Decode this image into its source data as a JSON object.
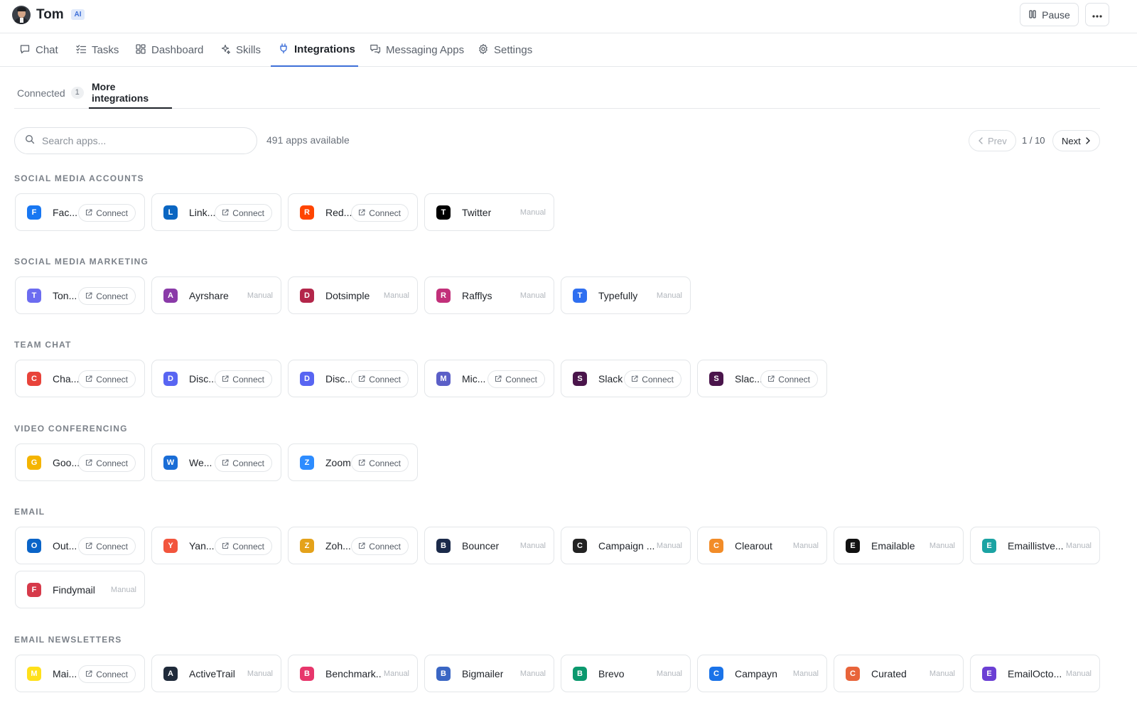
{
  "header": {
    "agent_name": "Tom",
    "ai_badge": "AI",
    "pause_label": "Pause"
  },
  "nav": {
    "tabs": [
      {
        "label": "Chat",
        "icon": "chat-icon"
      },
      {
        "label": "Tasks",
        "icon": "tasks-icon"
      },
      {
        "label": "Dashboard",
        "icon": "dashboard-icon"
      },
      {
        "label": "Skills",
        "icon": "sparkle-icon"
      },
      {
        "label": "Integrations",
        "icon": "plug-icon",
        "active": true
      },
      {
        "label": "Messaging Apps",
        "icon": "messages-icon"
      },
      {
        "label": "Settings",
        "icon": "gear-icon"
      }
    ]
  },
  "subtabs": {
    "connected_label": "Connected",
    "connected_count": "1",
    "more_label": "More integrations"
  },
  "search": {
    "placeholder": "Search apps...",
    "apps_count": "491 apps available"
  },
  "pagination": {
    "prev": "Prev",
    "page": "1 / 10",
    "next": "Next"
  },
  "connect_label": "Connect",
  "manual_label": "Manual",
  "sections": [
    {
      "title": "SOCIAL MEDIA ACCOUNTS",
      "cards": [
        {
          "name": "Fac...",
          "action": "connect",
          "icon": "facebook-icon",
          "color": "#1877f2"
        },
        {
          "name": "Link...",
          "action": "connect",
          "icon": "linkedin-icon",
          "color": "#0a66c2"
        },
        {
          "name": "Red...",
          "action": "connect",
          "icon": "reddit-icon",
          "color": "#ff4500"
        },
        {
          "name": "Twitter",
          "action": "manual",
          "icon": "x-twitter-icon",
          "color": "#000000"
        }
      ]
    },
    {
      "title": "SOCIAL MEDIA MARKETING",
      "cards": [
        {
          "name": "Ton...",
          "action": "connect",
          "icon": "tone-icon",
          "color": "#6c6cf0"
        },
        {
          "name": "Ayrshare",
          "action": "manual",
          "icon": "ayrshare-icon",
          "color": "#8a3aa8"
        },
        {
          "name": "Dotsimple",
          "action": "manual",
          "icon": "dotsimple-icon",
          "color": "#b3264a"
        },
        {
          "name": "Rafflys",
          "action": "manual",
          "icon": "rafflys-icon",
          "color": "#c2307a"
        },
        {
          "name": "Typefully",
          "action": "manual",
          "icon": "typefully-icon",
          "color": "#2f6ff0"
        }
      ]
    },
    {
      "title": "TEAM CHAT",
      "cards": [
        {
          "name": "Cha...",
          "action": "connect",
          "icon": "chatwork-icon",
          "color": "#e8433a"
        },
        {
          "name": "Disc...",
          "action": "connect",
          "icon": "discord-icon",
          "color": "#5865f2"
        },
        {
          "name": "Disc...",
          "action": "connect",
          "icon": "discord-icon",
          "color": "#5865f2"
        },
        {
          "name": "Mic...",
          "action": "connect",
          "icon": "microsoft-teams-icon",
          "color": "#5b5fc7"
        },
        {
          "name": "Slack",
          "action": "connect",
          "icon": "slack-icon",
          "color": "#4a154b"
        },
        {
          "name": "Slac...",
          "action": "connect",
          "icon": "slack-icon",
          "color": "#4a154b"
        }
      ]
    },
    {
      "title": "VIDEO CONFERENCING",
      "cards": [
        {
          "name": "Goo...",
          "action": "connect",
          "icon": "google-meet-icon",
          "color": "#f4b400"
        },
        {
          "name": "We...",
          "action": "connect",
          "icon": "webex-icon",
          "color": "#1a6dd6"
        },
        {
          "name": "Zoom",
          "action": "connect",
          "icon": "zoom-icon",
          "color": "#2d8cff"
        }
      ]
    },
    {
      "title": "EMAIL",
      "cards": [
        {
          "name": "Out...",
          "action": "connect",
          "icon": "outlook-icon",
          "color": "#0a64c8"
        },
        {
          "name": "Yan...",
          "action": "connect",
          "icon": "yandex-icon",
          "color": "#f2553d"
        },
        {
          "name": "Zoh...",
          "action": "connect",
          "icon": "zoho-icon",
          "color": "#e4a21a"
        },
        {
          "name": "Bouncer",
          "action": "manual",
          "icon": "bouncer-icon",
          "color": "#1b2a4a"
        },
        {
          "name": "Campaign ...",
          "action": "manual",
          "icon": "campaign-icon",
          "color": "#222222"
        },
        {
          "name": "Clearout",
          "action": "manual",
          "icon": "clearout-icon",
          "color": "#f28c28"
        },
        {
          "name": "Emailable",
          "action": "manual",
          "icon": "emailable-icon",
          "color": "#111111"
        },
        {
          "name": "Emaillistve...",
          "action": "manual",
          "icon": "checkmark-icon",
          "color": "#1ba3a3"
        },
        {
          "name": "Findymail",
          "action": "manual",
          "icon": "findymail-icon",
          "color": "#d63a4a"
        }
      ]
    },
    {
      "title": "EMAIL NEWSLETTERS",
      "cards": [
        {
          "name": "Mai...",
          "action": "connect",
          "icon": "mailchimp-icon",
          "color": "#ffe01b"
        },
        {
          "name": "ActiveTrail",
          "action": "manual",
          "icon": "activetrail-icon",
          "color": "#1f2a3a"
        },
        {
          "name": "Benchmark...",
          "action": "manual",
          "icon": "benchmark-icon",
          "color": "#e7366b"
        },
        {
          "name": "Bigmailer",
          "action": "manual",
          "icon": "bigmailer-icon",
          "color": "#3a66c4"
        },
        {
          "name": "Brevo",
          "action": "manual",
          "icon": "brevo-icon",
          "color": "#0b996e"
        },
        {
          "name": "Campayn",
          "action": "manual",
          "icon": "campayn-icon",
          "color": "#1a73e8"
        },
        {
          "name": "Curated",
          "action": "manual",
          "icon": "curated-icon",
          "color": "#e8643a"
        },
        {
          "name": "EmailOcto...",
          "action": "manual",
          "icon": "emailoctopus-icon",
          "color": "#6b3fd4"
        }
      ]
    }
  ]
}
